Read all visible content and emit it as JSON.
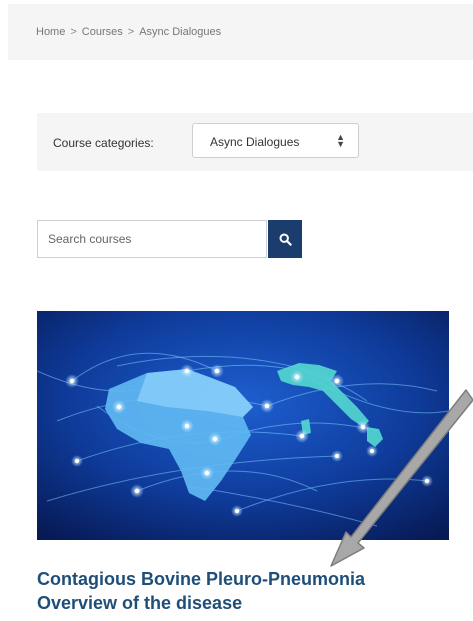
{
  "breadcrumb": {
    "items": [
      "Home",
      "Courses",
      "Async Dialogues"
    ],
    "separator": ">"
  },
  "category_filter": {
    "label": "Course categories:",
    "selected": "Async Dialogues"
  },
  "search": {
    "placeholder": "Search courses",
    "button_icon": "search-icon"
  },
  "course": {
    "image_icon": "world-network-map",
    "title_line1": "Contagious Bovine Pleuro-Pneumonia",
    "title_line2": "Overview of the disease"
  },
  "annotation": {
    "icon": "arrow-pointer-icon"
  },
  "colors": {
    "accent": "#1a3d6e",
    "title": "#1f4e79",
    "bar_bg": "#f5f5f5"
  }
}
